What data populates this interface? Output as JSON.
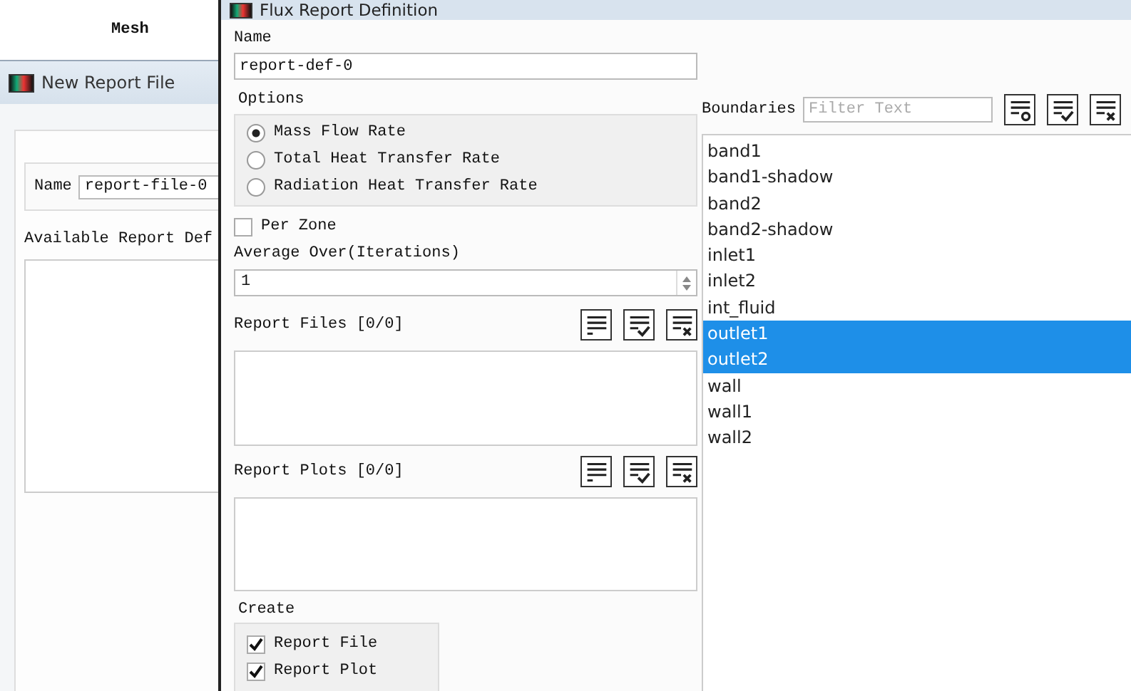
{
  "background": {
    "label": "Mesh"
  },
  "new_report_file": {
    "title": "New Report File",
    "name_label": "Name",
    "name_value": "report-file-0",
    "available_label": "Available Report Def"
  },
  "flux_dialog": {
    "title": "Flux Report Definition",
    "name_label": "Name",
    "name_value": "report-def-0",
    "options_label": "Options",
    "options": [
      {
        "label": "Mass Flow Rate",
        "selected": true
      },
      {
        "label": "Total Heat Transfer Rate",
        "selected": false
      },
      {
        "label": "Radiation Heat Transfer Rate",
        "selected": false
      }
    ],
    "per_zone": {
      "label": "Per Zone",
      "checked": false
    },
    "average_over": {
      "label": "Average Over(Iterations)",
      "value": "1"
    },
    "report_files": {
      "label": "Report Files [0/0]"
    },
    "report_plots": {
      "label": "Report Plots [0/0]"
    },
    "create": {
      "label": "Create",
      "items": [
        {
          "label": "Report File",
          "checked": true
        },
        {
          "label": "Report Plot",
          "checked": true
        }
      ]
    },
    "boundaries": {
      "label": "Boundaries",
      "filter_placeholder": "Filter Text",
      "items": [
        {
          "label": "band1",
          "selected": false
        },
        {
          "label": "band1-shadow",
          "selected": false
        },
        {
          "label": "band2",
          "selected": false
        },
        {
          "label": "band2-shadow",
          "selected": false
        },
        {
          "label": "inlet1",
          "selected": false
        },
        {
          "label": "inlet2",
          "selected": false
        },
        {
          "label": "int_fluid",
          "selected": false
        },
        {
          "label": "outlet1",
          "selected": true
        },
        {
          "label": "outlet2",
          "selected": true
        },
        {
          "label": "wall",
          "selected": false
        },
        {
          "label": "wall1",
          "selected": false
        },
        {
          "label": "wall2",
          "selected": false
        }
      ]
    }
  }
}
